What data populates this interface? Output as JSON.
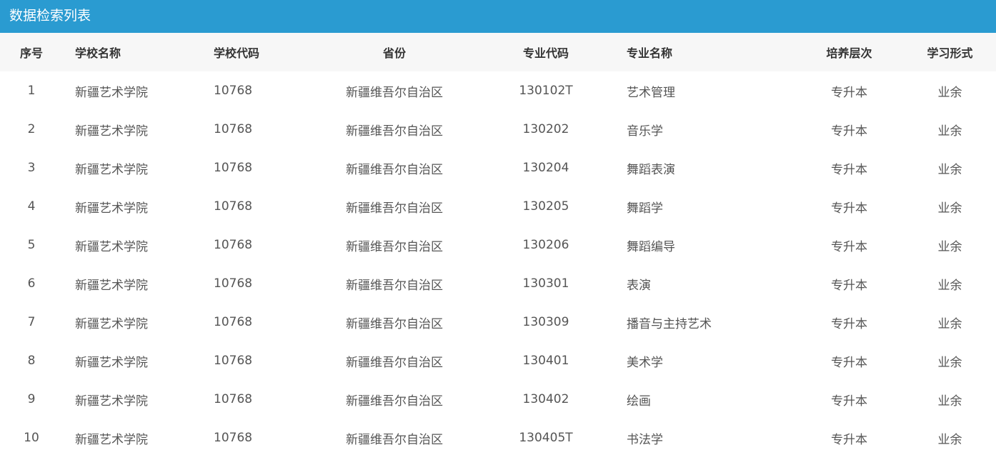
{
  "panel": {
    "title": "数据检索列表"
  },
  "table": {
    "headers": [
      "序号",
      "学校名称",
      "学校代码",
      "省份",
      "专业代码",
      "专业名称",
      "培养层次",
      "学习形式"
    ],
    "rows": [
      [
        "1",
        "新疆艺术学院",
        "10768",
        "新疆维吾尔自治区",
        "130102T",
        "艺术管理",
        "专升本",
        "业余"
      ],
      [
        "2",
        "新疆艺术学院",
        "10768",
        "新疆维吾尔自治区",
        "130202",
        "音乐学",
        "专升本",
        "业余"
      ],
      [
        "3",
        "新疆艺术学院",
        "10768",
        "新疆维吾尔自治区",
        "130204",
        "舞蹈表演",
        "专升本",
        "业余"
      ],
      [
        "4",
        "新疆艺术学院",
        "10768",
        "新疆维吾尔自治区",
        "130205",
        "舞蹈学",
        "专升本",
        "业余"
      ],
      [
        "5",
        "新疆艺术学院",
        "10768",
        "新疆维吾尔自治区",
        "130206",
        "舞蹈编导",
        "专升本",
        "业余"
      ],
      [
        "6",
        "新疆艺术学院",
        "10768",
        "新疆维吾尔自治区",
        "130301",
        "表演",
        "专升本",
        "业余"
      ],
      [
        "7",
        "新疆艺术学院",
        "10768",
        "新疆维吾尔自治区",
        "130309",
        "播音与主持艺术",
        "专升本",
        "业余"
      ],
      [
        "8",
        "新疆艺术学院",
        "10768",
        "新疆维吾尔自治区",
        "130401",
        "美术学",
        "专升本",
        "业余"
      ],
      [
        "9",
        "新疆艺术学院",
        "10768",
        "新疆维吾尔自治区",
        "130402",
        "绘画",
        "专升本",
        "业余"
      ],
      [
        "10",
        "新疆艺术学院",
        "10768",
        "新疆维吾尔自治区",
        "130405T",
        "书法学",
        "专升本",
        "业余"
      ]
    ]
  },
  "colors": {
    "header_bg": "#2a9bd1",
    "thead_bg": "#f7f7f7"
  }
}
